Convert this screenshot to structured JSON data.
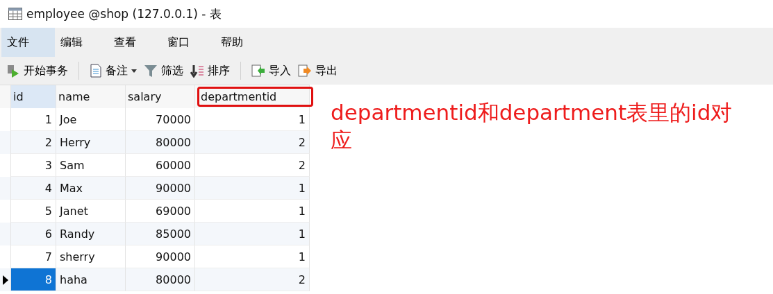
{
  "window": {
    "title": "employee @shop (127.0.0.1) - 表"
  },
  "menu": [
    {
      "label": "文件",
      "selected": true
    },
    {
      "label": "编辑",
      "selected": false
    },
    {
      "label": "查看",
      "selected": false
    },
    {
      "label": "窗口",
      "selected": false
    },
    {
      "label": "帮助",
      "selected": false
    }
  ],
  "toolbar": [
    {
      "kind": "transaction",
      "label": "开始事务"
    },
    {
      "kind": "separator"
    },
    {
      "kind": "memo",
      "label": "备注"
    },
    {
      "kind": "filter",
      "label": "筛选"
    },
    {
      "kind": "sort",
      "label": "排序"
    },
    {
      "kind": "separator"
    },
    {
      "kind": "import",
      "label": "导入"
    },
    {
      "kind": "export",
      "label": "导出"
    }
  ],
  "table": {
    "columns": [
      {
        "label": "id",
        "selected": true,
        "highlighted": false
      },
      {
        "label": "name",
        "selected": false,
        "highlighted": false
      },
      {
        "label": "salary",
        "selected": false,
        "highlighted": false
      },
      {
        "label": "departmentid",
        "selected": false,
        "highlighted": true
      }
    ],
    "rows": [
      {
        "cells": [
          "1",
          "Joe",
          "70000",
          "1"
        ],
        "selected": false
      },
      {
        "cells": [
          "2",
          "Herry",
          "80000",
          "2"
        ],
        "selected": false
      },
      {
        "cells": [
          "3",
          "Sam",
          "60000",
          "2"
        ],
        "selected": false
      },
      {
        "cells": [
          "4",
          "Max",
          "90000",
          "1"
        ],
        "selected": false
      },
      {
        "cells": [
          "5",
          "Janet",
          "69000",
          "1"
        ],
        "selected": false
      },
      {
        "cells": [
          "6",
          "Randy",
          "85000",
          "1"
        ],
        "selected": false
      },
      {
        "cells": [
          "7",
          "sherry",
          "90000",
          "1"
        ],
        "selected": false
      },
      {
        "cells": [
          "8",
          "haha",
          "80000",
          "2"
        ],
        "selected": true
      }
    ]
  },
  "annotation": "departmentid和department表里的id对应"
}
